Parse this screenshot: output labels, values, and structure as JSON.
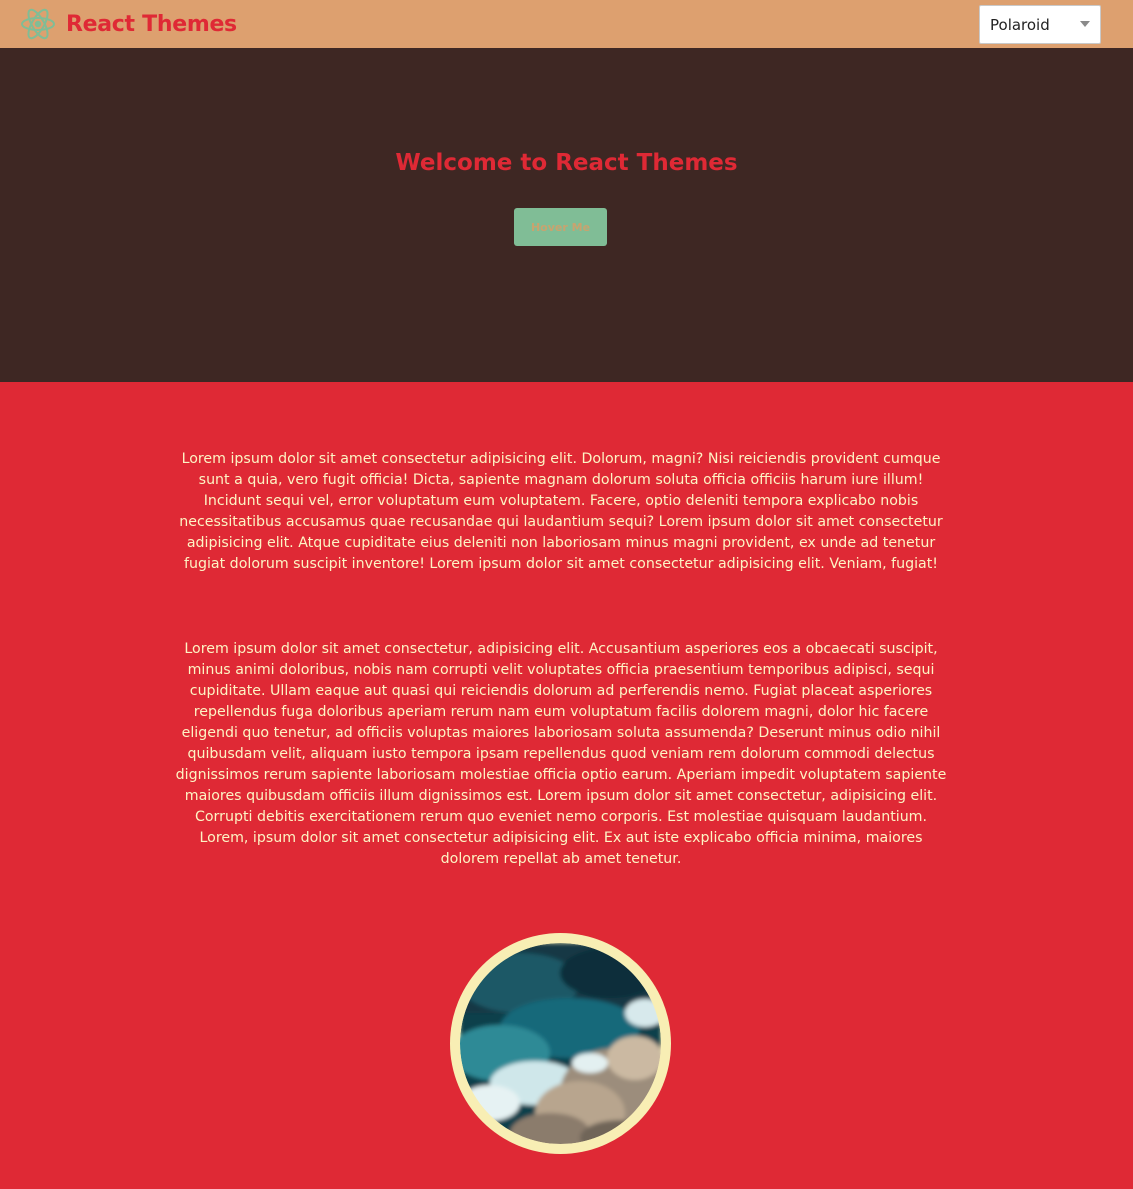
{
  "navbar": {
    "logo_icon": "react-atom-icon",
    "title": "React Themes",
    "theme_select": {
      "selected": "Polaroid",
      "caret_icon": "chevron-down-icon"
    }
  },
  "hero": {
    "title": "Welcome to React Themes",
    "button_label": "Hover Me"
  },
  "content": {
    "paragraph_1": "Lorem ipsum dolor sit amet consectetur adipisicing elit. Dolorum, magni? Nisi reiciendis provident cumque sunt a quia, vero fugit officia! Dicta, sapiente magnam dolorum soluta officia officiis harum iure illum! Incidunt sequi vel, error voluptatum eum voluptatem. Facere, optio deleniti tempora explicabo nobis necessitatibus accusamus quae recusandae qui laudantium sequi? Lorem ipsum dolor sit amet consectetur adipisicing elit. Atque cupiditate eius deleniti non laboriosam minus magni provident, ex unde ad tenetur fugiat dolorum suscipit inventore! Lorem ipsum dolor sit amet consectetur adipisicing elit. Veniam, fugiat!",
    "paragraph_2": "Lorem ipsum dolor sit amet consectetur, adipisicing elit. Accusantium asperiores eos a obcaecati suscipit, minus animi doloribus, nobis nam corrupti velit voluptates officia praesentium temporibus adipisci, sequi cupiditate. Ullam eaque aut quasi qui reiciendis dolorum ad perferendis nemo. Fugiat placeat asperiores repellendus fuga doloribus aperiam rerum nam eum voluptatum facilis dolorem magni, dolor hic facere eligendi quo tenetur, ad officiis voluptas maiores laboriosam soluta assumenda? Deserunt minus odio nihil quibusdam velit, aliquam iusto tempora ipsam repellendus quod veniam rem dolorum commodi delectus dignissimos rerum sapiente laboriosam molestiae officia optio earum. Aperiam impedit voluptatem sapiente maiores quibusdam officiis illum dignissimos est. Lorem ipsum dolor sit amet consectetur, adipisicing elit. Corrupti debitis exercitationem rerum quo eveniet nemo corporis. Est molestiae quisquam laudantium. Lorem, ipsum dolor sit amet consectetur adipisicing elit. Ex aut iste explicabo officia minima, maiores dolorem repellat ab amet tenetur.",
    "image_icon": "ocean-rocks-photo"
  },
  "colors": {
    "navbar_bg": "#dda06f",
    "brand_red": "#df2935",
    "hero_bg": "#3e2723",
    "button_bg": "#80bd96",
    "button_text": "#c8a36f",
    "content_bg": "#df2935",
    "paragraph_text": "#fdf4c4",
    "avatar_border": "#f8eeb4",
    "logo_color": "#80bd96"
  }
}
